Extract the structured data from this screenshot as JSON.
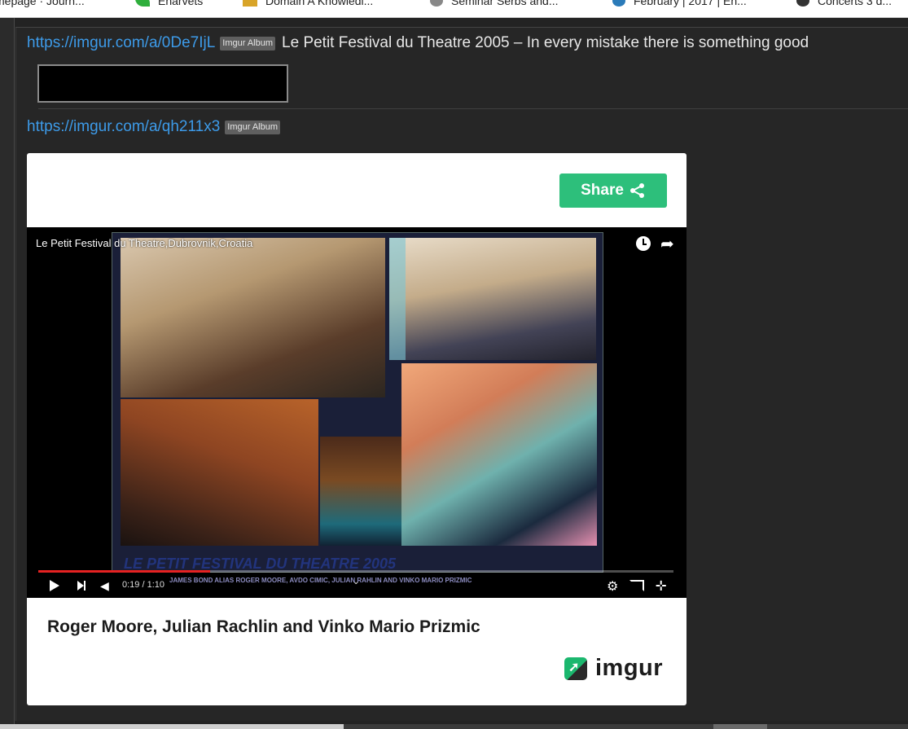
{
  "bookmarks": [
    {
      "label": "mepage · Journ...",
      "icon": "page-icon"
    },
    {
      "label": "Enarvets",
      "icon": "leaf-icon"
    },
    {
      "label": "Domain A Knowledi...",
      "icon": "folder-icon"
    },
    {
      "label": "Seminar Serbs and...",
      "icon": "globe-icon"
    },
    {
      "label": "February | 2017 | En...",
      "icon": "wordpress-icon"
    },
    {
      "label": "Concerts 3 d...",
      "icon": "moon-icon"
    }
  ],
  "post1": {
    "link": "https://imgur.com/a/0De7IjL",
    "tag": "Imgur Album",
    "title": "Le Petit Festival du Theatre 2005 – In every mistake there is something good"
  },
  "post2": {
    "link": "https://imgur.com/a/qh211x3",
    "tag": "Imgur Album"
  },
  "embed": {
    "share_label": "Share",
    "video_title": "Le Petit Festival du Theatre,Dubrovnik,Croatia",
    "slide_caption": "LE PETIT FESTIVAL DU THEATRE 2005",
    "slide_subcaption": "JAMES BOND ALIAS ROGER MOORE, AVDO CIMIC, JULIAN RAHLIN AND VINKO MARIO PRIZMIC",
    "time": "0:19 / 1:10",
    "progress_fraction": 0.27,
    "caption": "Roger Moore, Julian Rachlin and Vinko Mario Prizmic",
    "brand": "imgur"
  },
  "colors": {
    "link": "#3d9be9",
    "share": "#2dbf7b",
    "progress": "#e52222"
  }
}
